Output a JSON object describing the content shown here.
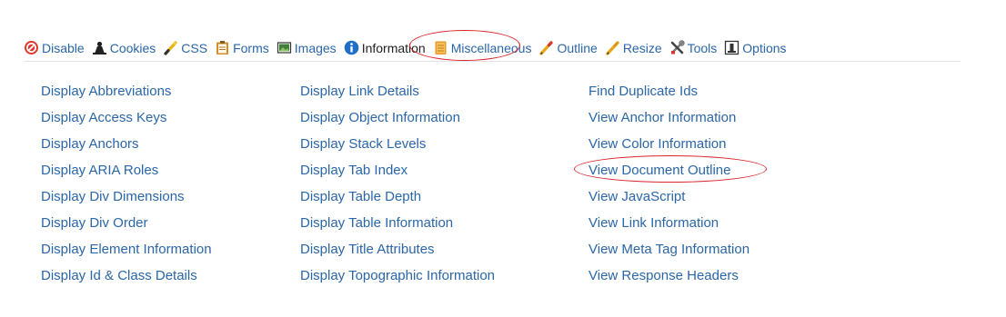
{
  "toolbar": {
    "items": [
      {
        "label": "Disable",
        "icon": "disable-icon"
      },
      {
        "label": "Cookies",
        "icon": "cookies-icon"
      },
      {
        "label": "CSS",
        "icon": "css-icon"
      },
      {
        "label": "Forms",
        "icon": "forms-icon"
      },
      {
        "label": "Images",
        "icon": "images-icon"
      },
      {
        "label": "Information",
        "icon": "information-icon"
      },
      {
        "label": "Miscellaneous",
        "icon": "miscellaneous-icon"
      },
      {
        "label": "Outline",
        "icon": "outline-icon"
      },
      {
        "label": "Resize",
        "icon": "resize-icon"
      },
      {
        "label": "Tools",
        "icon": "tools-icon"
      },
      {
        "label": "Options",
        "icon": "options-icon"
      }
    ],
    "active": "Information"
  },
  "menu": {
    "col1": [
      "Display Abbreviations",
      "Display Access Keys",
      "Display Anchors",
      "Display ARIA Roles",
      "Display Div Dimensions",
      "Display Div Order",
      "Display Element Information",
      "Display Id & Class Details"
    ],
    "col2": [
      "Display Link Details",
      "Display Object Information",
      "Display Stack Levels",
      "Display Tab Index",
      "Display Table Depth",
      "Display Table Information",
      "Display Title Attributes",
      "Display Topographic Information"
    ],
    "col3": [
      "Find Duplicate Ids",
      "View Anchor Information",
      "View Color Information",
      "View Document Outline",
      "View JavaScript",
      "View Link Information",
      "View Meta Tag Information",
      "View Response Headers"
    ]
  },
  "colors": {
    "link": "#2a66a8",
    "highlight": "#d9262c"
  }
}
